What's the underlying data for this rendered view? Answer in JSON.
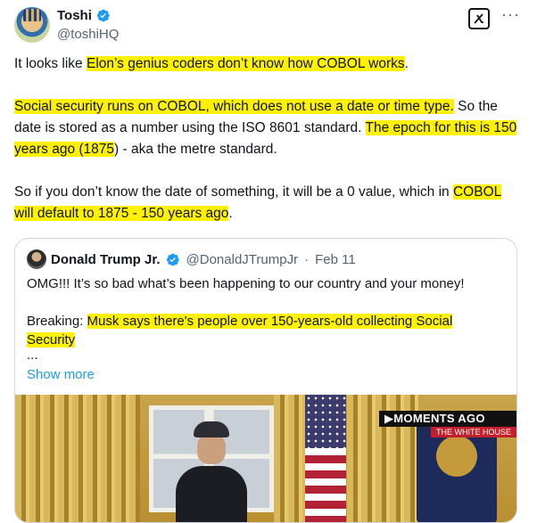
{
  "author": {
    "name": "Toshi",
    "handle": "@toshiHQ"
  },
  "header_icons": {
    "grok": "grok-icon",
    "more": "more-horizontal-icon",
    "more_glyph": "···"
  },
  "tweet": {
    "l1a": "It looks like ",
    "l1b": "Elon’s genius coders don’t know how COBOL works",
    "l1c": ".",
    "l2a": "Social security runs on COBOL, which does not use a date or time type.",
    "l2b": " So the date is stored as a number using the ISO 8601 standard.  ",
    "l2c": "The epoch for this is 150 years ago (1875",
    "l2d": ") - aka the metre standard.",
    "l3a": "So if you don’t know the date of something, it will be a 0 value, which in ",
    "l3b": "COBOL will default to 1875 - 150 years ago",
    "l3c": "."
  },
  "quoted": {
    "name": "Donald Trump Jr.",
    "handle": "@DonaldJTrumpJr",
    "separator": "·",
    "date": "Feb 11",
    "line1": "OMG!!! It’s so bad what’s been happening to our country and your money!",
    "line2a": "Breaking: ",
    "line2b": "Musk says there's people over 150-years-old collecting Social Security",
    "ellipsis": "...",
    "show_more": "Show more",
    "media": {
      "banner_top": "▶MOMENTS AGO",
      "banner_bottom": "THE WHITE HOUSE"
    }
  },
  "colors": {
    "highlight": "#fff200",
    "link": "#1d9bf0",
    "verified": "#1d9bf0",
    "secondary_text": "#536471"
  }
}
